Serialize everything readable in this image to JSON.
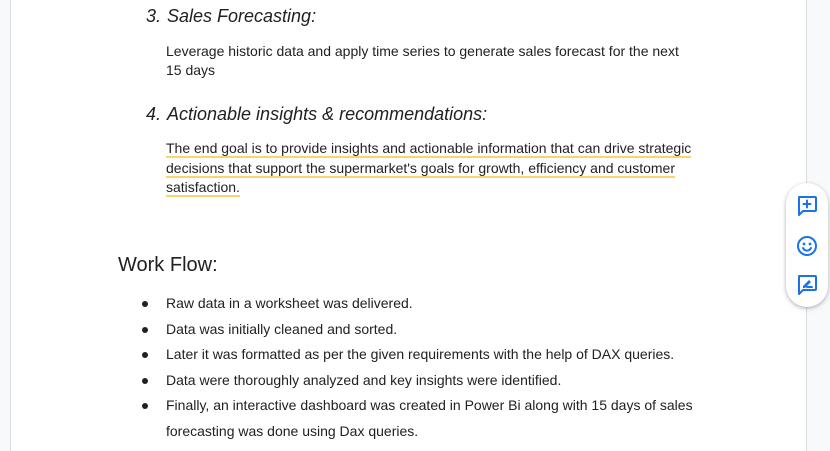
{
  "sections": {
    "item3": {
      "number": "3.",
      "title": "Sales Forecasting:",
      "lines": [
        "Leverage historic data and apply time series to generate sales forecast for the next",
        "15 days"
      ]
    },
    "item4": {
      "number": "4.",
      "title": "Actionable insights & recommendations:",
      "lines": [
        "The end goal is to provide insights and actionable information that can drive strategic",
        "decisions that support the supermarket's goals for growth, efficiency and customer",
        "satisfaction."
      ]
    }
  },
  "workflow": {
    "title": "Work Flow:",
    "bullets": [
      "Raw data in a worksheet was delivered.",
      "Data was initially cleaned and sorted.",
      "Later it was formatted as per the given requirements with the help of DAX queries.",
      "Data were thoroughly analyzed and key insights were identified.",
      "Finally, an interactive dashboard was created in Power Bi along with 15 days of sales",
      "forecasting was done using Dax queries."
    ]
  },
  "toolbar": {
    "icons": [
      "add-comment-icon",
      "emoji-reaction-icon",
      "suggest-edit-icon"
    ],
    "accent_color": "#1a73e8"
  },
  "colors": {
    "highlight_underline": "#f9d56e",
    "text": "#202124"
  }
}
